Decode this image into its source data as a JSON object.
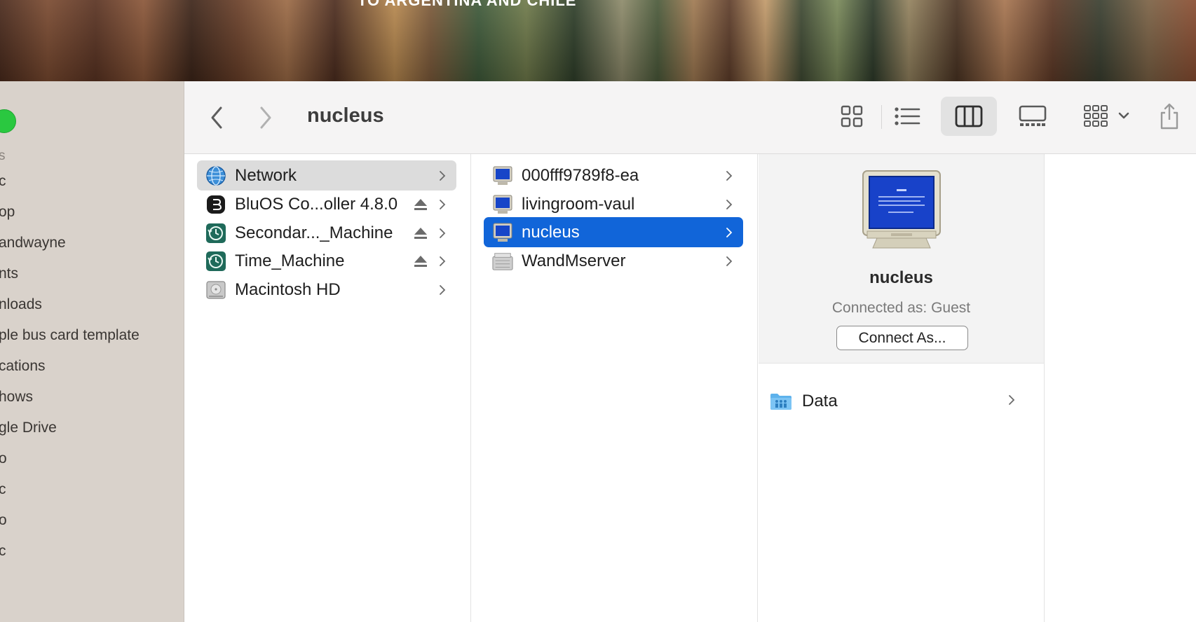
{
  "wallpaper": {
    "caption": "TO ARGENTINA AND CHILE"
  },
  "window": {
    "title": "nucleus"
  },
  "sidebar": {
    "items": [
      "s",
      "c",
      "op",
      "andwayne",
      "nts",
      "nloads",
      "ple bus card template",
      "cations",
      "hows",
      "gle Drive",
      "o",
      "c",
      "o",
      "c"
    ]
  },
  "toolbar": {
    "views": [
      "icon-view",
      "list-view",
      "column-view",
      "gallery-view"
    ],
    "active_view": "column-view"
  },
  "columns": {
    "locations": [
      {
        "label": "Network",
        "icon": "network-globe-icon",
        "eject": false,
        "selected": true
      },
      {
        "label": "BluOS Co...oller 4.8.0",
        "icon": "bluos-app-icon",
        "eject": true
      },
      {
        "label": "Secondar..._Machine",
        "icon": "time-machine-icon",
        "eject": true
      },
      {
        "label": "Time_Machine",
        "icon": "time-machine-icon",
        "eject": true
      },
      {
        "label": "Macintosh HD",
        "icon": "hard-drive-icon",
        "eject": false
      }
    ],
    "network": [
      {
        "label": "000fff9789f8-ea",
        "icon": "computer-icon"
      },
      {
        "label": "livingroom-vaul",
        "icon": "computer-icon"
      },
      {
        "label": "nucleus",
        "icon": "computer-icon",
        "selected": true
      },
      {
        "label": "WandMserver",
        "icon": "server-icon"
      }
    ]
  },
  "preview": {
    "name": "nucleus",
    "connected_as": "Connected as: Guest",
    "connect_button": "Connect As...",
    "shares": [
      {
        "label": "Data",
        "icon": "shared-folder-icon"
      }
    ]
  },
  "colors": {
    "selection_blue": "#1165d9",
    "traffic_green": "#2ac840"
  }
}
